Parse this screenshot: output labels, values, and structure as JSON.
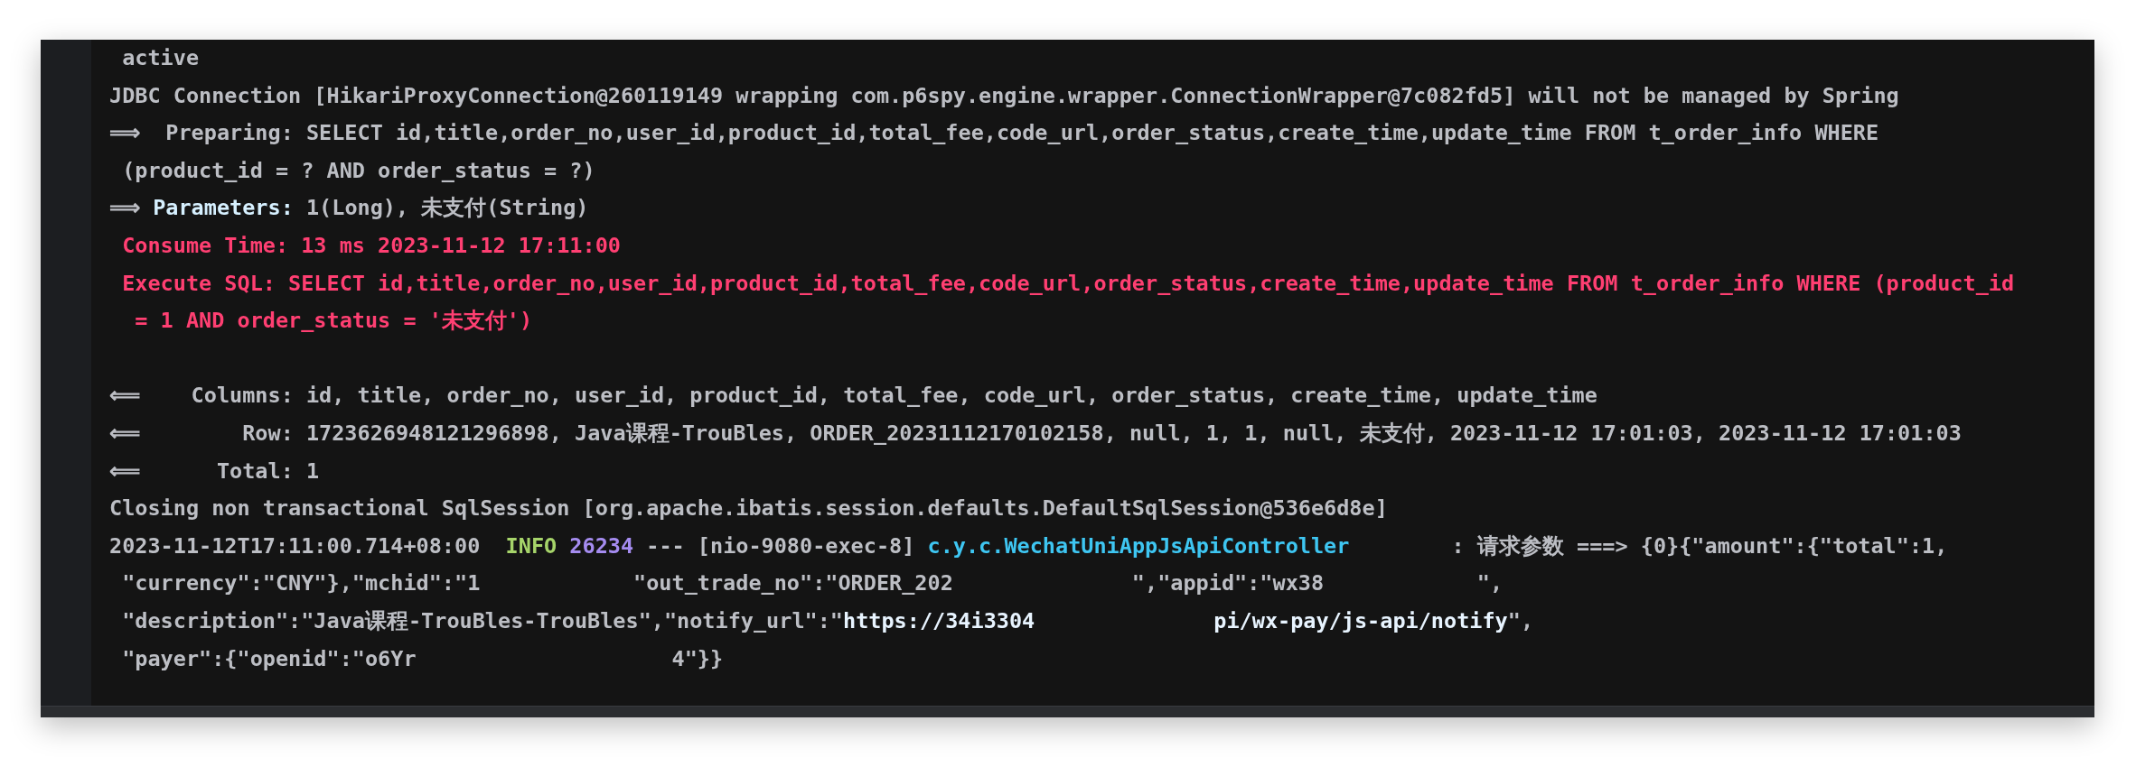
{
  "console": {
    "lines": [
      {
        "segments": [
          {
            "text": " active",
            "kind": "plain"
          }
        ]
      },
      {
        "segments": [
          {
            "text": "JDBC Connection [HikariProxyConnection@260119149 wrapping com.p6spy.engine.wrapper.ConnectionWrapper@7c082fd5] will not be managed by Spring",
            "kind": "plain"
          }
        ]
      },
      {
        "segments": [
          {
            "text": "⟹  Preparing: SELECT id,title,order_no,user_id,product_id,total_fee,code_url,order_status,create_time,update_time FROM t_order_info WHERE",
            "kind": "plain"
          }
        ]
      },
      {
        "segments": [
          {
            "text": " (product_id = ? AND order_status = ?)",
            "kind": "plain"
          }
        ]
      },
      {
        "segments": [
          {
            "text": "⟹ ",
            "kind": "plain"
          },
          {
            "text": "Parameters:",
            "kind": "label"
          },
          {
            "text": " 1(Long), 未支付(String)",
            "kind": "plain"
          }
        ]
      },
      {
        "segments": [
          {
            "text": " Consume Time: 13 ms 2023-11-12 17:11:00",
            "kind": "sql"
          }
        ]
      },
      {
        "segments": [
          {
            "text": " Execute SQL: SELECT id,title,order_no,user_id,product_id,total_fee,code_url,order_status,create_time,update_time FROM t_order_info WHERE (product_id",
            "kind": "sql"
          }
        ]
      },
      {
        "segments": [
          {
            "text": "  = 1 AND order_status = '未支付')",
            "kind": "sql"
          }
        ]
      },
      {
        "blank_line_before": true,
        "segments": [
          {
            "text": "⟸    Columns: id, title, order_no, user_id, product_id, total_fee, code_url, order_status, create_time, update_time",
            "kind": "plain"
          }
        ]
      },
      {
        "segments": [
          {
            "text": "⟸        Row: 1723626948121296898, Java课程-TrouBles, ORDER_20231112170102158, null, 1, 1, null, 未支付, 2023-11-12 17:01:03, 2023-11-12 17:01:03",
            "kind": "plain"
          }
        ]
      },
      {
        "segments": [
          {
            "text": "⟸      Total: 1",
            "kind": "plain"
          }
        ]
      },
      {
        "segments": [
          {
            "text": "Closing non transactional SqlSession [org.apache.ibatis.session.defaults.DefaultSqlSession@536e6d8e]",
            "kind": "plain"
          }
        ]
      },
      {
        "segments": [
          {
            "text": "2023-11-12T17:11:00.714+08:00  ",
            "kind": "plain"
          },
          {
            "text": "INFO",
            "kind": "level"
          },
          {
            "text": " 26234",
            "kind": "pid"
          },
          {
            "text": " --- [nio-9080-exec-8] ",
            "kind": "plain"
          },
          {
            "text": "c.y.c.WechatUniAppJsApiController",
            "kind": "logger"
          },
          {
            "text": "        : 请求参数 ===> {0}{\"amount\":{\"total\":1,",
            "kind": "plain"
          }
        ]
      },
      {
        "segments": [
          {
            "text": " \"currency\":\"CNY\"},\"mchid\":\"1            \"out_trade_no\":\"ORDER_202              \",\"appid\":\"wx38            \",",
            "kind": "plain"
          }
        ]
      },
      {
        "segments": [
          {
            "text": " \"description\":\"Java课程-TrouBles-TrouBles\",\"notify_url\":\"",
            "kind": "plain"
          },
          {
            "text": "https://34i3304              pi/wx-pay/js-api/notify",
            "kind": "link"
          },
          {
            "text": "\",",
            "kind": "plain"
          }
        ]
      },
      {
        "segments": [
          {
            "text": " \"payer\":{\"openid\":\"o6Yr                    4\"}}",
            "kind": "plain"
          }
        ]
      }
    ]
  }
}
